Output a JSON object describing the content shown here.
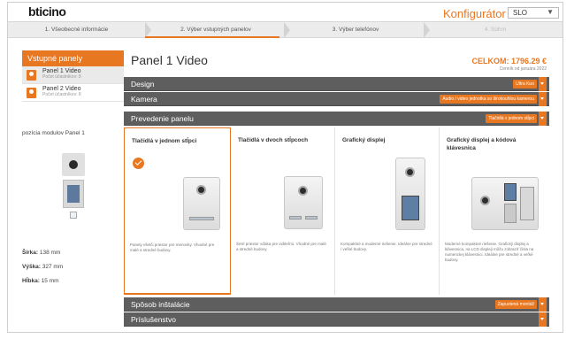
{
  "header": {
    "logo_text": "bticino",
    "configurator_label": "Konfigurátor",
    "language": "SLO",
    "accent_color": "#e87722"
  },
  "steps": [
    {
      "label": "1. Všeobecné informácie",
      "state": "done"
    },
    {
      "label": "2. Výber vstupných panelov",
      "state": "active"
    },
    {
      "label": "3. Výber telefónov",
      "state": "pending"
    },
    {
      "label": "4. Súhrn",
      "state": "disabled"
    }
  ],
  "sidebar": {
    "heading": "Vstupné panely",
    "items": [
      {
        "title": "Panel 1 Video",
        "subtitle": "Počet účastníkov: 8",
        "active": true
      },
      {
        "title": "Panel 2 Video",
        "subtitle": "Počet účastníkov: 8",
        "active": false
      }
    ],
    "module_label": "pozícia modulov Panel 1",
    "dimensions": [
      {
        "label": "Šírka:",
        "value": "138 mm"
      },
      {
        "label": "Výška:",
        "value": "327 mm"
      },
      {
        "label": "Hĺbka:",
        "value": "15 mm"
      }
    ]
  },
  "main": {
    "title": "Panel 1 Video",
    "total": "CELKOM: 1796.29 €",
    "price_note": "Cenník od januára 2022",
    "sections_top": [
      {
        "title": "Design",
        "tag": "Ultra Kuo"
      },
      {
        "title": "Kamera",
        "tag": "Audio / video jednotka so širokouhlou kamerou"
      },
      {
        "title": "Prevedenie panelu",
        "tag": "Tlačidlá v jednom stĺpci"
      }
    ],
    "options": [
      {
        "title": "Tlačidlá v jednom stĺpci",
        "desc": "Panely všetči priestor pre menovky. Vhodné pre malé a stredné budovy.",
        "selected": true
      },
      {
        "title": "Tlačidlá v dvoch stĺpcoch",
        "desc": "Šetrí priestor vďaka pre viditeľnú. Vhodné pre malé a stredné budovy.",
        "selected": false
      },
      {
        "title": "Grafický displej",
        "desc": "Kompaktné a moderné riešenie. Ideálne pre stredné / veľké budovy.",
        "selected": false
      },
      {
        "title": "Grafický displej a kódová klávesnica",
        "desc": "Moderné kompaktné riešenie. Grafický displej a klávesnica, na LCD displeji môžu zobraziť čísla na numerickej klávesnici. Ideálne pre stredné a veľké budovy.",
        "selected": false
      }
    ],
    "sections_bottom": [
      {
        "title": "Spôsob inštalácie",
        "tag": "Zapustená montáž"
      },
      {
        "title": "Príslušenstvo",
        "tag": ""
      }
    ]
  }
}
